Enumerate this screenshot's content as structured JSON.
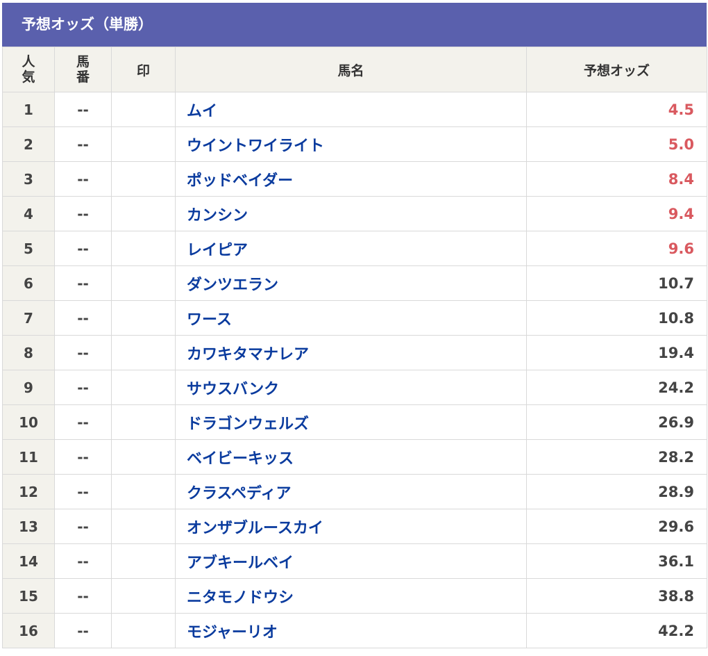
{
  "title": "予想オッズ（単勝）",
  "headers": {
    "rank": "人気",
    "rank_line1": "人",
    "rank_line2": "気",
    "number_line1": "馬",
    "number_line2": "番",
    "mark": "印",
    "horse_name": "馬名",
    "odds": "予想オッズ"
  },
  "colors": {
    "header_bar": "#5a60ad",
    "header_cell_bg": "#f3f2ec",
    "horse_name": "#0a3b9e",
    "odds_favorite": "#d9595f",
    "odds_normal": "#444444"
  },
  "rows": [
    {
      "rank": "1",
      "number": "--",
      "mark": "",
      "name": "ムイ",
      "odds": "4.5",
      "hot": true
    },
    {
      "rank": "2",
      "number": "--",
      "mark": "",
      "name": "ウイントワイライト",
      "odds": "5.0",
      "hot": true
    },
    {
      "rank": "3",
      "number": "--",
      "mark": "",
      "name": "ポッドベイダー",
      "odds": "8.4",
      "hot": true
    },
    {
      "rank": "4",
      "number": "--",
      "mark": "",
      "name": "カンシン",
      "odds": "9.4",
      "hot": true
    },
    {
      "rank": "5",
      "number": "--",
      "mark": "",
      "name": "レイピア",
      "odds": "9.6",
      "hot": true
    },
    {
      "rank": "6",
      "number": "--",
      "mark": "",
      "name": "ダンツエラン",
      "odds": "10.7",
      "hot": false
    },
    {
      "rank": "7",
      "number": "--",
      "mark": "",
      "name": "ワース",
      "odds": "10.8",
      "hot": false
    },
    {
      "rank": "8",
      "number": "--",
      "mark": "",
      "name": "カワキタマナレア",
      "odds": "19.4",
      "hot": false
    },
    {
      "rank": "9",
      "number": "--",
      "mark": "",
      "name": "サウスバンク",
      "odds": "24.2",
      "hot": false
    },
    {
      "rank": "10",
      "number": "--",
      "mark": "",
      "name": "ドラゴンウェルズ",
      "odds": "26.9",
      "hot": false
    },
    {
      "rank": "11",
      "number": "--",
      "mark": "",
      "name": "ベイビーキッス",
      "odds": "28.2",
      "hot": false
    },
    {
      "rank": "12",
      "number": "--",
      "mark": "",
      "name": "クラスペディア",
      "odds": "28.9",
      "hot": false
    },
    {
      "rank": "13",
      "number": "--",
      "mark": "",
      "name": "オンザブルースカイ",
      "odds": "29.6",
      "hot": false
    },
    {
      "rank": "14",
      "number": "--",
      "mark": "",
      "name": "アブキールベイ",
      "odds": "36.1",
      "hot": false
    },
    {
      "rank": "15",
      "number": "--",
      "mark": "",
      "name": "ニタモノドウシ",
      "odds": "38.8",
      "hot": false
    },
    {
      "rank": "16",
      "number": "--",
      "mark": "",
      "name": "モジャーリオ",
      "odds": "42.2",
      "hot": false
    }
  ]
}
